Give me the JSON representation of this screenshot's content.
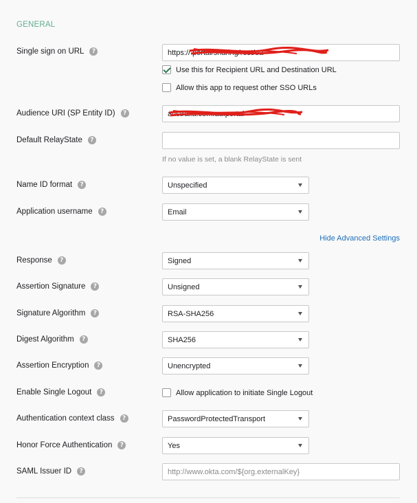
{
  "section": {
    "title": "GENERAL"
  },
  "sso_url": {
    "label": "Single sign on URL",
    "value": "https://                                   portal/sharing/rest/oa",
    "recipient_checkbox_label": "Use this for Recipient URL and Destination URL",
    "recipient_checked": true,
    "other_sso_checkbox_label": "Allow this app to request other SSO URLs",
    "other_sso_checked": false
  },
  "audience_uri": {
    "label": "Audience URI (SP Entity ID)",
    "value": "                              australia.com.au.portal"
  },
  "relay_state": {
    "label": "Default RelayState",
    "value": "",
    "hint": "If no value is set, a blank RelayState is sent"
  },
  "name_id_format": {
    "label": "Name ID format",
    "value": "Unspecified"
  },
  "app_username": {
    "label": "Application username",
    "value": "Email"
  },
  "advanced_link": "Hide Advanced Settings",
  "response": {
    "label": "Response",
    "value": "Signed"
  },
  "assertion_signature": {
    "label": "Assertion Signature",
    "value": "Unsigned"
  },
  "signature_algorithm": {
    "label": "Signature Algorithm",
    "value": "RSA-SHA256"
  },
  "digest_algorithm": {
    "label": "Digest Algorithm",
    "value": "SHA256"
  },
  "assertion_encryption": {
    "label": "Assertion Encryption",
    "value": "Unencrypted"
  },
  "single_logout": {
    "label": "Enable Single Logout",
    "checkbox_label": "Allow application to initiate Single Logout",
    "checked": false
  },
  "auth_context": {
    "label": "Authentication context class",
    "value": "PasswordProtectedTransport"
  },
  "honor_force_auth": {
    "label": "Honor Force Authentication",
    "value": "Yes"
  },
  "saml_issuer": {
    "label": "SAML Issuer ID",
    "placeholder": "http://www.okta.com/${org.externalKey}"
  },
  "help_glyph": "?",
  "colors": {
    "section_title": "#5eb08f",
    "link": "#1e6fb7",
    "redaction": "#e0201b"
  }
}
